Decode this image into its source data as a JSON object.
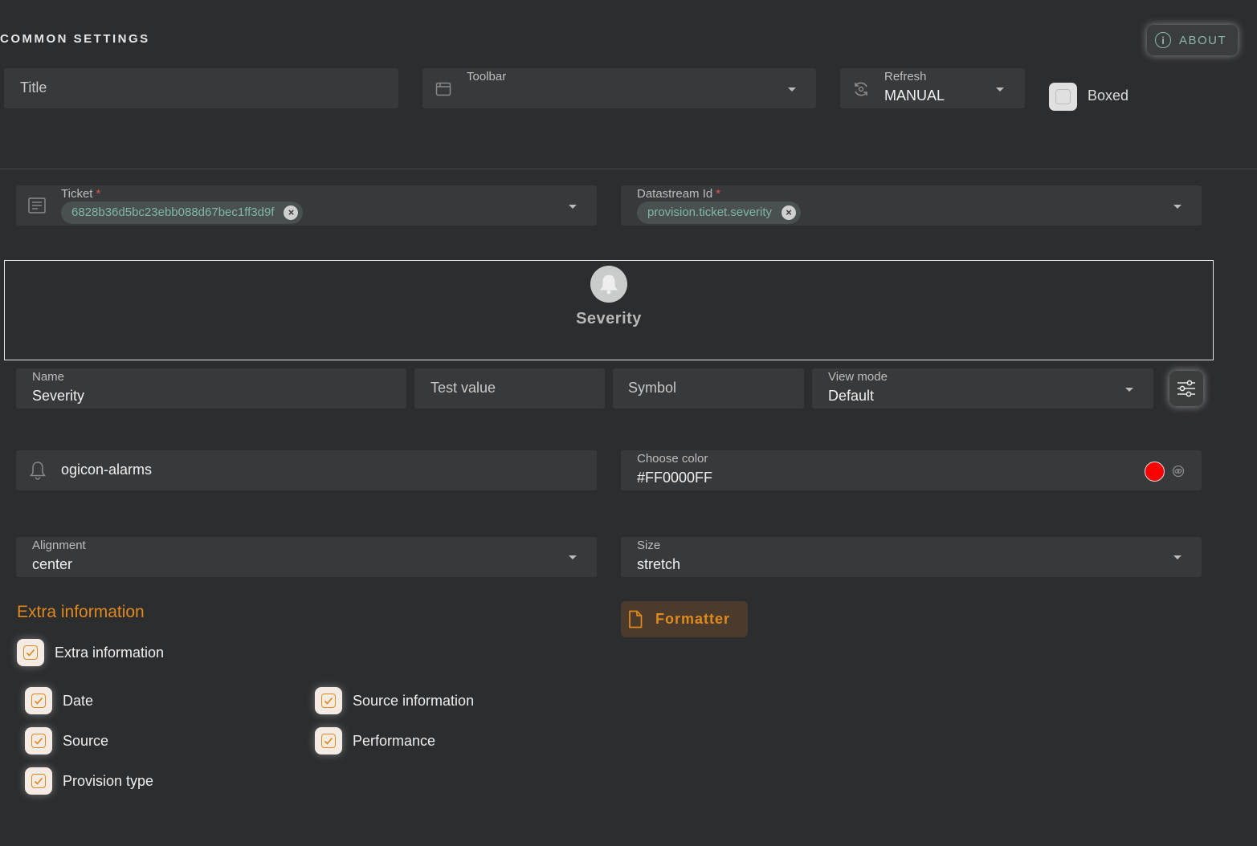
{
  "common": {
    "section_title": "COMMON SETTINGS",
    "about_label": "ABOUT",
    "title_placeholder": "Title",
    "toolbar_label": "Toolbar",
    "refresh_label": "Refresh",
    "refresh_value": "MANUAL",
    "boxed_label": "Boxed"
  },
  "data_source": {
    "ticket_label": "Ticket",
    "ticket_required": "*",
    "ticket_chip": "6828b36d5bc23ebb088d67bec1ff3d9f",
    "datastream_label": "Datastream Id",
    "datastream_required": "*",
    "datastream_chip": "provision.ticket.severity"
  },
  "preview": {
    "title": "Severity",
    "icon": "bell-icon"
  },
  "field_config": {
    "name_label": "Name",
    "name_value": "Severity",
    "test_value_placeholder": "Test value",
    "symbol_placeholder": "Symbol",
    "view_mode_label": "View mode",
    "view_mode_value": "Default",
    "icon_value": "ogicon-alarms",
    "color_label": "Choose color",
    "color_value": "#FF0000FF",
    "color_swatch": "#ff0000",
    "alignment_label": "Alignment",
    "alignment_value": "center",
    "size_label": "Size",
    "size_value": "stretch"
  },
  "extra": {
    "heading": "Extra information",
    "formatter_label": "Formatter",
    "master_checkbox": "Extra information",
    "options": {
      "date": "Date",
      "source": "Source",
      "provision_type": "Provision type",
      "source_information": "Source information",
      "performance": "Performance"
    }
  },
  "colors": {
    "accent": "#e08a1e",
    "background": "#2c2d2f",
    "field": "#38393b"
  }
}
